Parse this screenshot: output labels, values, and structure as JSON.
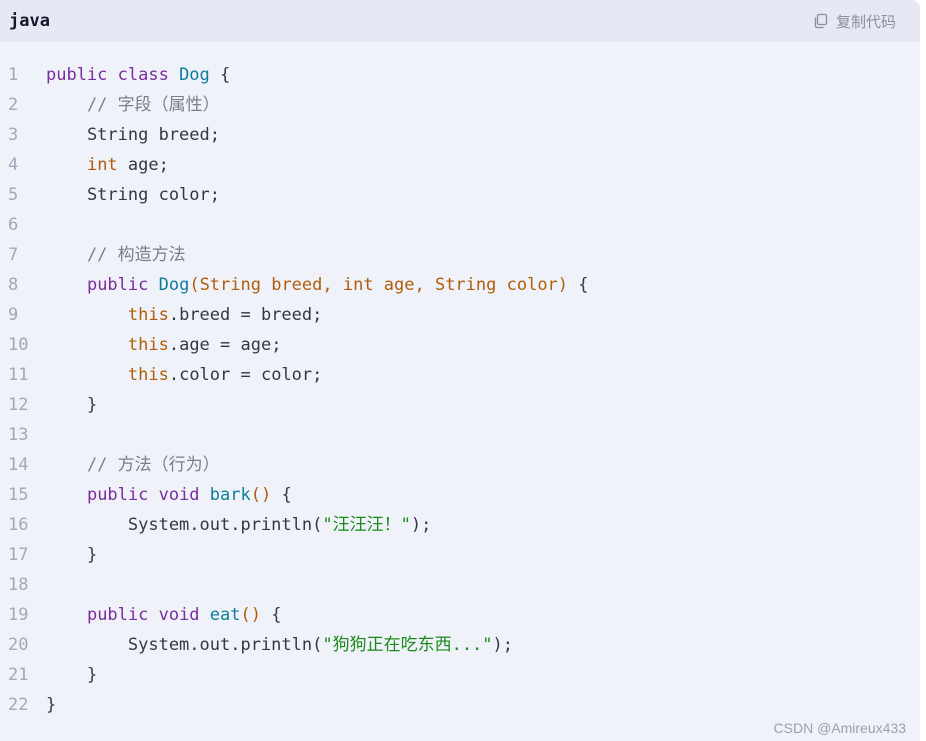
{
  "header": {
    "language": "java",
    "copy_label": "复制代码",
    "copy_icon": "copy-icon"
  },
  "watermark": "CSDN @Amireux433",
  "colors": {
    "keyword": "#7b2d9e",
    "type": "#b05d0a",
    "class": "#0d7d99",
    "comment": "#7a7f8c",
    "string": "#1b8a1b",
    "background": "#f0f2f9",
    "header": "#e6e9f3"
  },
  "code": {
    "lines": [
      {
        "n": "1",
        "tokens": [
          [
            "public class ",
            "kw"
          ],
          [
            "Dog",
            "cls"
          ],
          [
            " {",
            "plain"
          ]
        ]
      },
      {
        "n": "2",
        "tokens": [
          [
            "    // 字段（属性）",
            "com"
          ]
        ]
      },
      {
        "n": "3",
        "tokens": [
          [
            "    String breed;",
            "plain"
          ]
        ]
      },
      {
        "n": "4",
        "tokens": [
          [
            "    ",
            "plain"
          ],
          [
            "int",
            "type"
          ],
          [
            " age;",
            "plain"
          ]
        ]
      },
      {
        "n": "5",
        "tokens": [
          [
            "    String color;",
            "plain"
          ]
        ]
      },
      {
        "n": "6",
        "tokens": []
      },
      {
        "n": "7",
        "tokens": [
          [
            "    // 构造方法",
            "com"
          ]
        ]
      },
      {
        "n": "8",
        "tokens": [
          [
            "    ",
            "plain"
          ],
          [
            "public ",
            "kw"
          ],
          [
            "Dog",
            "fn"
          ],
          [
            "(String breed, int age, String color)",
            "punc"
          ],
          [
            " {",
            "plain"
          ]
        ]
      },
      {
        "n": "9",
        "tokens": [
          [
            "        ",
            "plain"
          ],
          [
            "this",
            "type"
          ],
          [
            ".breed = breed;",
            "plain"
          ]
        ]
      },
      {
        "n": "10",
        "tokens": [
          [
            "        ",
            "plain"
          ],
          [
            "this",
            "type"
          ],
          [
            ".age = age;",
            "plain"
          ]
        ]
      },
      {
        "n": "11",
        "tokens": [
          [
            "        ",
            "plain"
          ],
          [
            "this",
            "type"
          ],
          [
            ".color = color;",
            "plain"
          ]
        ]
      },
      {
        "n": "12",
        "tokens": [
          [
            "    }",
            "plain"
          ]
        ]
      },
      {
        "n": "13",
        "tokens": []
      },
      {
        "n": "14",
        "tokens": [
          [
            "    // 方法（行为）",
            "com"
          ]
        ]
      },
      {
        "n": "15",
        "tokens": [
          [
            "    ",
            "plain"
          ],
          [
            "public void ",
            "kw"
          ],
          [
            "bark",
            "fn"
          ],
          [
            "()",
            "punc"
          ],
          [
            " {",
            "plain"
          ]
        ]
      },
      {
        "n": "16",
        "tokens": [
          [
            "        System.out.println(",
            "plain"
          ],
          [
            "\"汪汪汪！\"",
            "str"
          ],
          [
            ");",
            "plain"
          ]
        ]
      },
      {
        "n": "17",
        "tokens": [
          [
            "    }",
            "plain"
          ]
        ]
      },
      {
        "n": "18",
        "tokens": []
      },
      {
        "n": "19",
        "tokens": [
          [
            "    ",
            "plain"
          ],
          [
            "public void ",
            "kw"
          ],
          [
            "eat",
            "fn"
          ],
          [
            "()",
            "punc"
          ],
          [
            " {",
            "plain"
          ]
        ]
      },
      {
        "n": "20",
        "tokens": [
          [
            "        System.out.println(",
            "plain"
          ],
          [
            "\"狗狗正在吃东西...\"",
            "str"
          ],
          [
            ");",
            "plain"
          ]
        ]
      },
      {
        "n": "21",
        "tokens": [
          [
            "    }",
            "plain"
          ]
        ]
      },
      {
        "n": "22",
        "tokens": [
          [
            "}",
            "plain"
          ]
        ]
      }
    ]
  }
}
